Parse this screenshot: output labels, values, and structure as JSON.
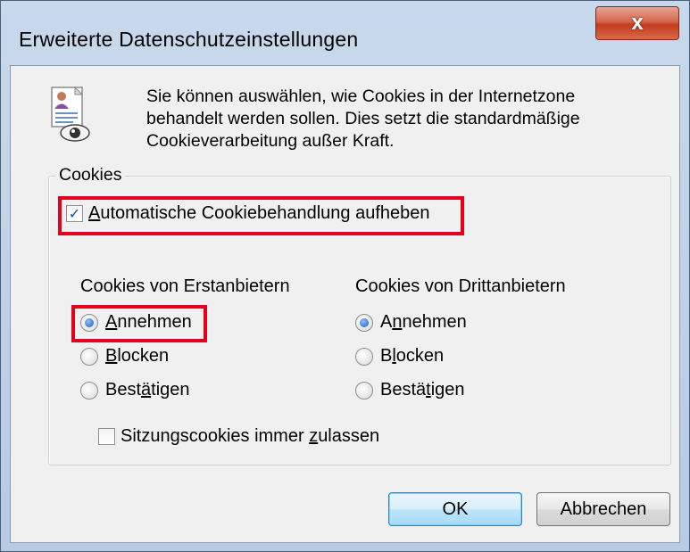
{
  "window": {
    "title": "Erweiterte Datenschutzeinstellungen",
    "close_label": "x"
  },
  "info": {
    "icon": "privacy-document-eye-icon",
    "line1": "Sie können auswählen, wie Cookies in der Internetzone",
    "line2": "behandelt werden sollen. Dies setzt die standardmäßige",
    "line3": "Cookieverarbeitung außer Kraft."
  },
  "cookies_group": {
    "label": "Cookies",
    "override": {
      "label_prefix": "",
      "label_accel": "A",
      "label_rest": "utomatische Cookiebehandlung aufheben",
      "checked": true
    },
    "first_party": {
      "title": "Cookies von Erstanbietern",
      "options": [
        {
          "accel": "A",
          "rest": "nnehmen",
          "selected": true
        },
        {
          "accel": "B",
          "rest": "locken",
          "selected": false
        },
        {
          "pre": "Best",
          "accel": "ä",
          "rest": "tigen",
          "selected": false
        }
      ]
    },
    "third_party": {
      "title": "Cookies von Drittanbietern",
      "options": [
        {
          "pre": "A",
          "accel": "n",
          "rest": "nehmen",
          "selected": true
        },
        {
          "pre": "B",
          "accel": "l",
          "rest": "ocken",
          "selected": false
        },
        {
          "pre": "Bestä",
          "accel": "t",
          "rest": "igen",
          "selected": false
        }
      ]
    },
    "session": {
      "pre": "Sitzungscookies immer ",
      "accel": "z",
      "rest": "ulassen",
      "checked": false
    }
  },
  "buttons": {
    "ok": "OK",
    "cancel": "Abbrechen"
  },
  "colors": {
    "highlight": "#e2001a",
    "radio_dot": "#1a58b8",
    "check_mark": "#1d4c9a"
  }
}
